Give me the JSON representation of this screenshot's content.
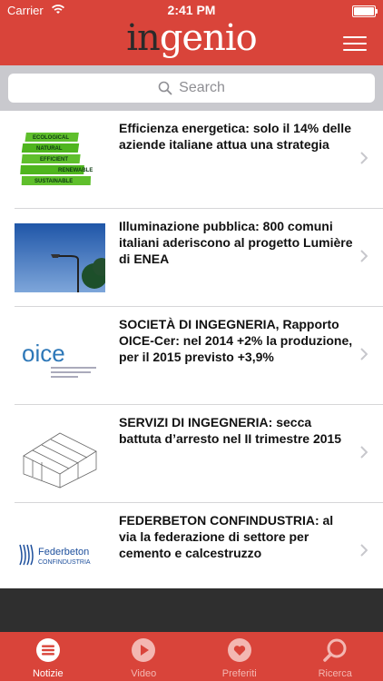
{
  "status_bar": {
    "carrier": "Carrier",
    "time": "2:41 PM"
  },
  "header": {
    "logo_part1": "in",
    "logo_part2": "genio",
    "menu_icon": "hamburger-menu-icon"
  },
  "search": {
    "placeholder": "Search"
  },
  "articles": [
    {
      "title": "Efficienza energetica: solo il 14% delle aziende italiane attua una strategia",
      "thumb_text": [
        "ECOLOGICAL",
        "NATURAL",
        "EFFICIENT",
        "RENEWABLE",
        "SUSTAINABLE"
      ]
    },
    {
      "title": "Illuminazione pubblica: 800 comuni italiani aderiscono al progetto Lumière di ENEA"
    },
    {
      "title": "SOCIETÀ DI INGEGNERIA, Rapporto OICE-Cer: nel 2014 +2% la produzione, per il 2015 previsto +3,9%",
      "thumb_text": "oice"
    },
    {
      "title": "SERVIZI DI INGEGNERIA: secca battuta d’arresto nel II trimestre 2015"
    },
    {
      "title": "FEDERBETON CONFINDUSTRIA: al via la federazione di settore per cemento e calcestruzzo",
      "thumb_text": [
        "Federbeton",
        "CONFINDUSTRIA"
      ]
    }
  ],
  "tabbar": [
    {
      "label": "Notizie",
      "icon": "list-icon",
      "active": true
    },
    {
      "label": "Video",
      "icon": "play-icon",
      "active": false
    },
    {
      "label": "Preferiti",
      "icon": "heart-icon",
      "active": false
    },
    {
      "label": "Ricerca",
      "icon": "search-icon",
      "active": false
    }
  ],
  "colors": {
    "brand_red": "#d9443a",
    "tab_inactive": "#f3b7b2"
  }
}
